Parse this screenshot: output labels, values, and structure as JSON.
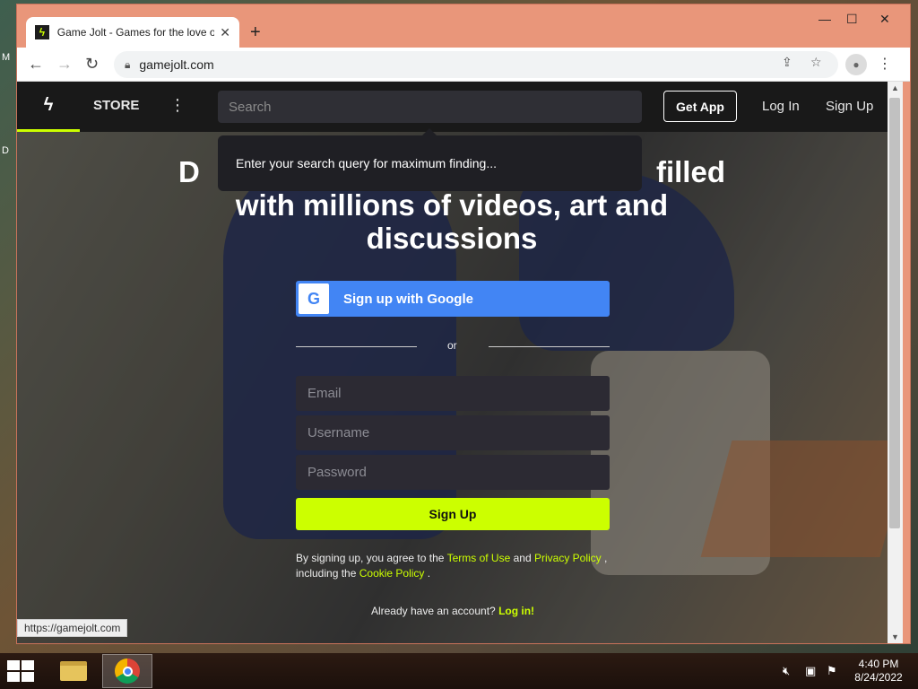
{
  "desktop": {
    "letters": [
      "M",
      "D"
    ]
  },
  "browser": {
    "tab": {
      "title": "Game Jolt - Games for the love of",
      "favicon": "game-jolt-logo",
      "close": "✕"
    },
    "new_tab": "+",
    "window_controls": {
      "minimize": "—",
      "maximize": "☐",
      "close": "✕"
    },
    "nav": {
      "back": "←",
      "forward": "→",
      "reload": "↻"
    },
    "url": "gamejolt.com",
    "status_url": "https://gamejolt.com"
  },
  "site": {
    "logo": "ϟ",
    "store_label": "STORE",
    "more": "⋮",
    "search_placeholder": "Search",
    "get_app_label": "Get App",
    "login_label": "Log In",
    "signup_label": "Sign Up",
    "search_tooltip": "Enter your search query for maximum finding...",
    "hero_line1": "D",
    "hero_line1_end": "filled",
    "hero_line2": "with millions of videos, art and",
    "hero_line3": "discussions"
  },
  "signup": {
    "google_label": "Sign up with Google",
    "google_icon": "G",
    "or": "or",
    "email_placeholder": "Email",
    "username_placeholder": "Username",
    "password_placeholder": "Password",
    "button_label": "Sign Up",
    "terms": {
      "prefix": "By signing up, you agree to the",
      "terms_link": "Terms of Use",
      "and": "and",
      "privacy_link": "Privacy Policy",
      "comma": ",",
      "including": "including the",
      "cookie_link": "Cookie Policy",
      "period": "."
    },
    "already_text": "Already have an account?",
    "login_link": "Log in!"
  },
  "taskbar": {
    "clock_time": "4:40 PM",
    "clock_date": "8/24/2022"
  },
  "colors": {
    "accent": "#ccff00",
    "google_blue": "#4285f4",
    "nav_bg": "#191919"
  }
}
